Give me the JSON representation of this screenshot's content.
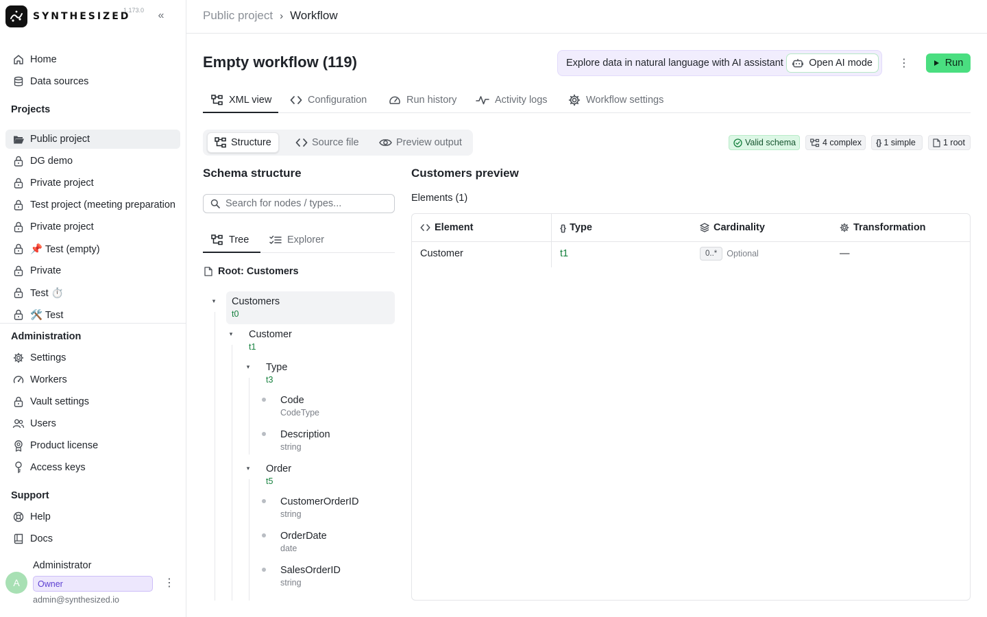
{
  "app": {
    "brand": "SYNTHESIZED",
    "version": "1.173.0"
  },
  "sidebar": {
    "top_items": [
      {
        "label": "Home",
        "icon": "home-icon"
      },
      {
        "label": "Data sources",
        "icon": "database-icon"
      }
    ],
    "projects_title": "Projects",
    "projects": [
      {
        "label": "Public project",
        "icon": "folder-open-icon",
        "active": true
      },
      {
        "label": "DG demo",
        "icon": "lock-icon"
      },
      {
        "label": "Private project",
        "icon": "lock-icon"
      },
      {
        "label": "Test project (meeting preparation",
        "icon": "lock-icon"
      },
      {
        "label": "Private project",
        "icon": "lock-icon"
      },
      {
        "label": "📌 Test (empty)",
        "icon": "lock-icon"
      },
      {
        "label": "Private",
        "icon": "lock-icon"
      },
      {
        "label": "Test ⏱️",
        "icon": "lock-icon"
      },
      {
        "label": "🛠️ Test",
        "icon": "lock-icon"
      }
    ],
    "admin_title": "Administration",
    "admin_items": [
      {
        "label": "Settings",
        "icon": "gear-icon"
      },
      {
        "label": "Workers",
        "icon": "gauge-icon"
      },
      {
        "label": "Vault settings",
        "icon": "lock-icon"
      },
      {
        "label": "Users",
        "icon": "users-icon"
      },
      {
        "label": "Product license",
        "icon": "badge-icon"
      },
      {
        "label": "Access keys",
        "icon": "key-icon"
      }
    ],
    "support_title": "Support",
    "support_items": [
      {
        "label": "Help",
        "icon": "lifebuoy-icon"
      },
      {
        "label": "Docs",
        "icon": "book-icon"
      }
    ],
    "user": {
      "initial": "A",
      "name": "Administrator",
      "role": "Owner",
      "email": "admin@synthesized.io"
    }
  },
  "header": {
    "breadcrumb_parent": "Public project",
    "breadcrumb_current": "Workflow",
    "page_title": "Empty workflow (119)",
    "ai_banner_text": "Explore data in natural language with AI assistant",
    "ai_button_label": "Open AI mode",
    "run_label": "Run"
  },
  "tabs": [
    {
      "label": "XML view",
      "icon": "schema-tree-icon",
      "active": true
    },
    {
      "label": "Configuration",
      "icon": "code-icon"
    },
    {
      "label": "Run history",
      "icon": "gauge-icon"
    },
    {
      "label": "Activity logs",
      "icon": "activity-icon"
    },
    {
      "label": "Workflow settings",
      "icon": "gear-icon"
    }
  ],
  "view_switch": [
    {
      "label": "Structure",
      "icon": "schema-tree-icon",
      "active": true
    },
    {
      "label": "Source file",
      "icon": "code-icon"
    },
    {
      "label": "Preview output",
      "icon": "eye-icon"
    }
  ],
  "badges": {
    "valid": "Valid schema",
    "complex": "4 complex",
    "simple": "1 simple",
    "root": "1 root"
  },
  "schema": {
    "title": "Schema structure",
    "search_placeholder": "Search for nodes / types...",
    "subtabs": [
      {
        "label": "Tree",
        "icon": "schema-tree-icon",
        "active": true
      },
      {
        "label": "Explorer",
        "icon": "checklist-icon"
      }
    ],
    "root_label": "Root: Customers",
    "nodes": [
      {
        "name": "Customers",
        "type": "t0",
        "kind": "ref"
      },
      {
        "name": "Customer",
        "type": "t1",
        "kind": "ref"
      },
      {
        "name": "Type",
        "type": "t3",
        "kind": "ref"
      },
      {
        "name": "Code",
        "type": "CodeType",
        "kind": "prim"
      },
      {
        "name": "Description",
        "type": "string",
        "kind": "prim"
      },
      {
        "name": "Order",
        "type": "t5",
        "kind": "ref"
      },
      {
        "name": "CustomerOrderID",
        "type": "string",
        "kind": "prim"
      },
      {
        "name": "OrderDate",
        "type": "date",
        "kind": "prim"
      },
      {
        "name": "SalesOrderID",
        "type": "string",
        "kind": "prim"
      }
    ]
  },
  "preview": {
    "title": "Customers preview",
    "elements_label": "Elements (1)",
    "columns": [
      {
        "label": "Element",
        "icon": "code-icon"
      },
      {
        "label": "Type",
        "icon": "braces-icon"
      },
      {
        "label": "Cardinality",
        "icon": "layers-icon"
      },
      {
        "label": "Transformation",
        "icon": "gear-icon"
      }
    ],
    "rows": [
      {
        "element": "Customer",
        "type": "t1",
        "cardinality": "0..*",
        "optional": "Optional",
        "transformation": "—"
      }
    ]
  },
  "colors": {
    "accent_green": "#4ade80",
    "type_ref_green": "#15803d",
    "ai_banner_bg": "#f1edfd",
    "owner_badge": "#ede7fd"
  }
}
